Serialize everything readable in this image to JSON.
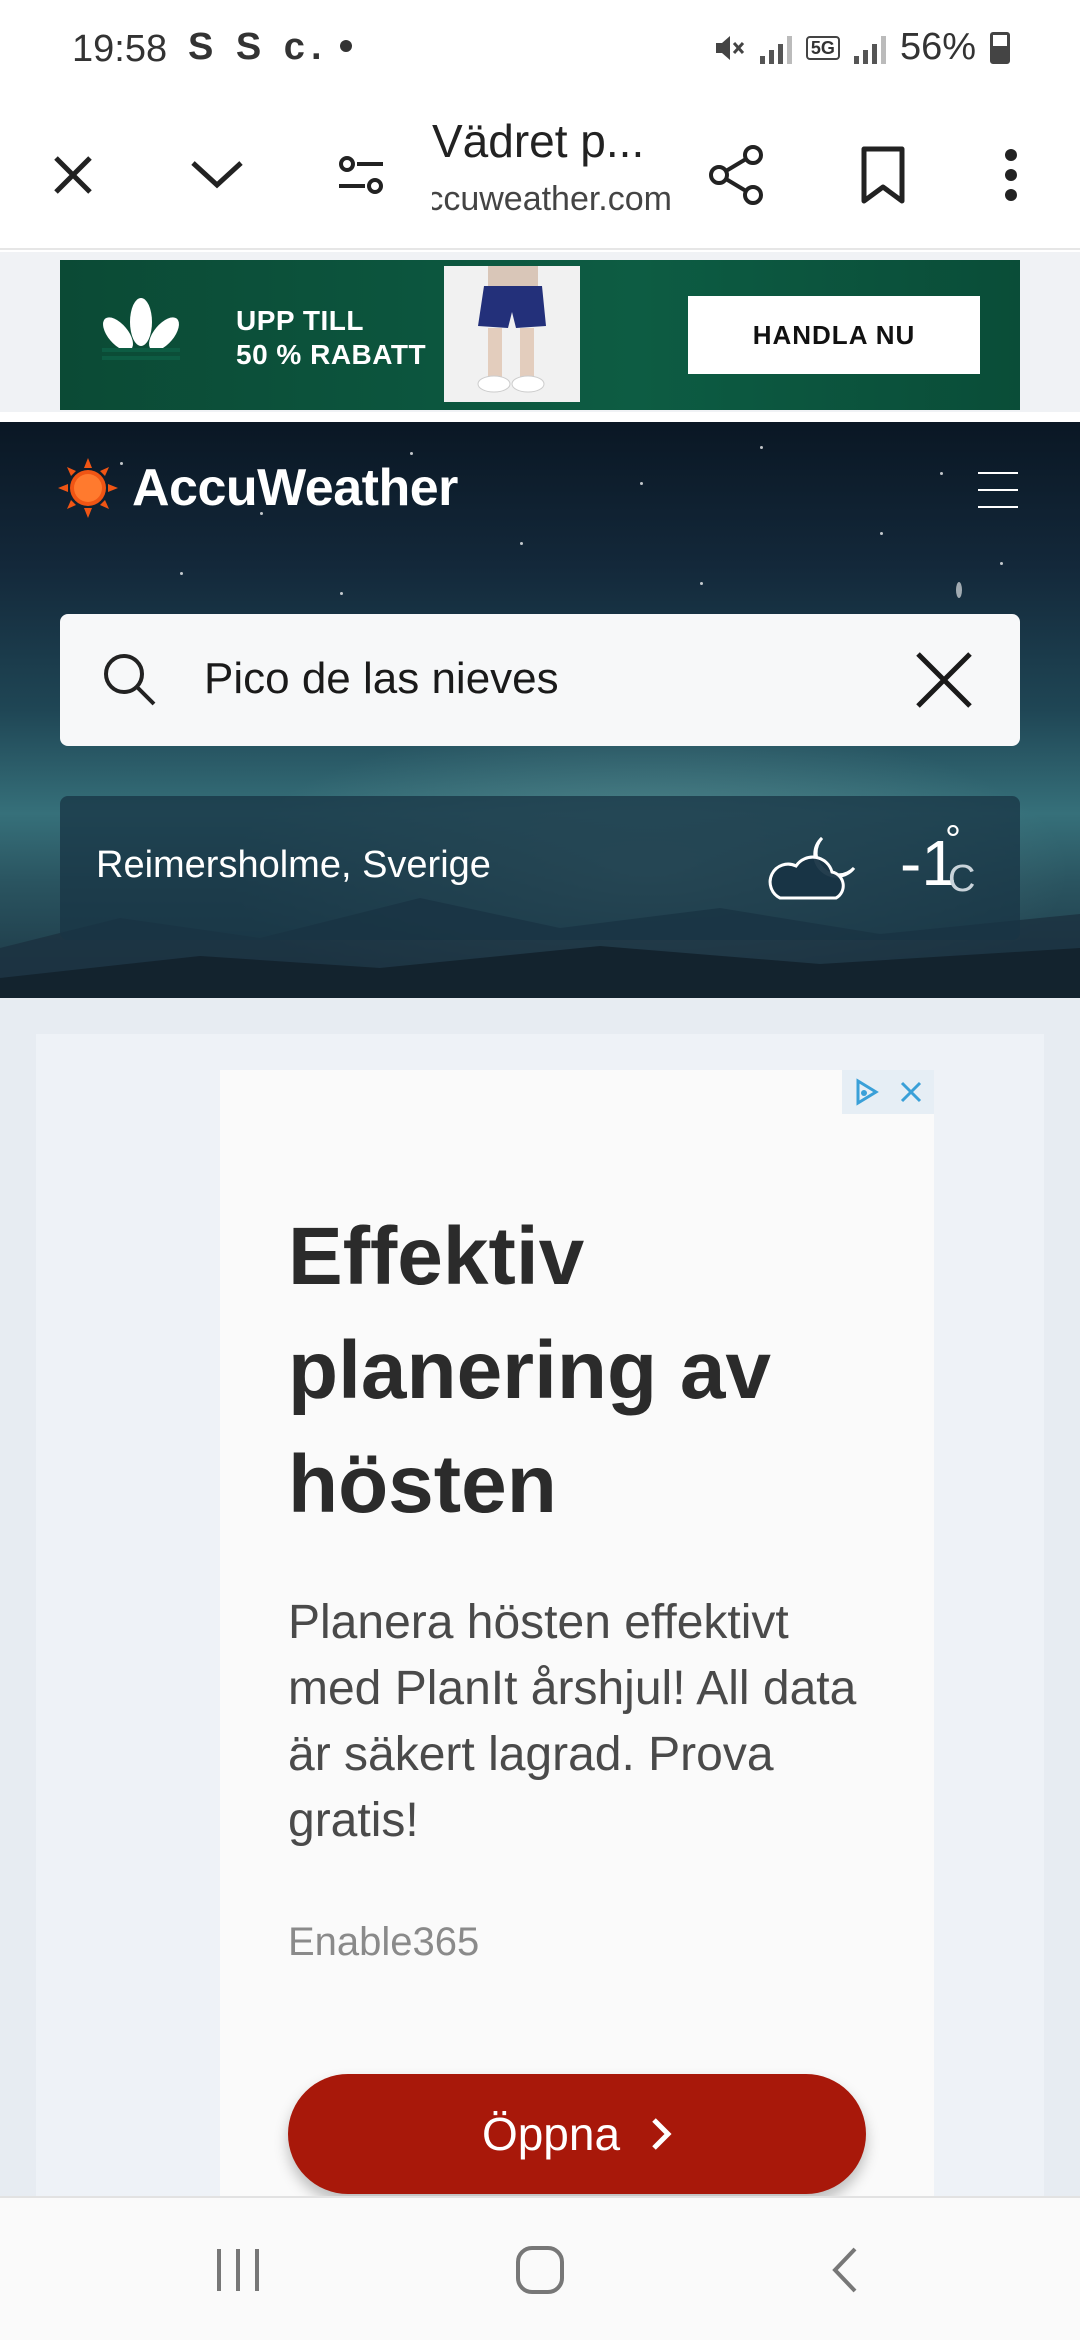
{
  "status_bar": {
    "time": "19:58",
    "left_icons": "S S c.",
    "network": "5G",
    "battery": "56%"
  },
  "browser": {
    "page_title": "Vädret p...",
    "url": "accuweather.com",
    "icons": [
      "close-icon",
      "chevron-down-icon",
      "page-settings-icon",
      "share-icon",
      "bookmark-icon",
      "more-icon"
    ]
  },
  "top_ad": {
    "line1": "UPP TILL",
    "line2": "50 % RABATT",
    "cta": "HANDLA NU",
    "colors": {
      "background": "#0d5c43",
      "cta_background": "#ffffff"
    }
  },
  "accuweather": {
    "logo_text": "AccuWeather",
    "search": {
      "value": "Pico de las nieves"
    },
    "location": {
      "name": "Reimersholme, Sverige",
      "temperature": "-1",
      "degree": "°",
      "unit": "C",
      "condition_icon": "partly-cloudy-night-icon"
    },
    "colors": {
      "logo_sun": "#f05514"
    }
  },
  "ad": {
    "headline": "Effektiv planering av hösten",
    "body": "Planera hösten effektivt med PlanIt årshjul! All data är säkert lagrad. Prova gratis!",
    "brand": "Enable365",
    "button": "Öppna",
    "colors": {
      "button": "#a8180a"
    }
  },
  "nav": {
    "icons": [
      "recent-apps-icon",
      "home-icon",
      "back-icon"
    ]
  }
}
